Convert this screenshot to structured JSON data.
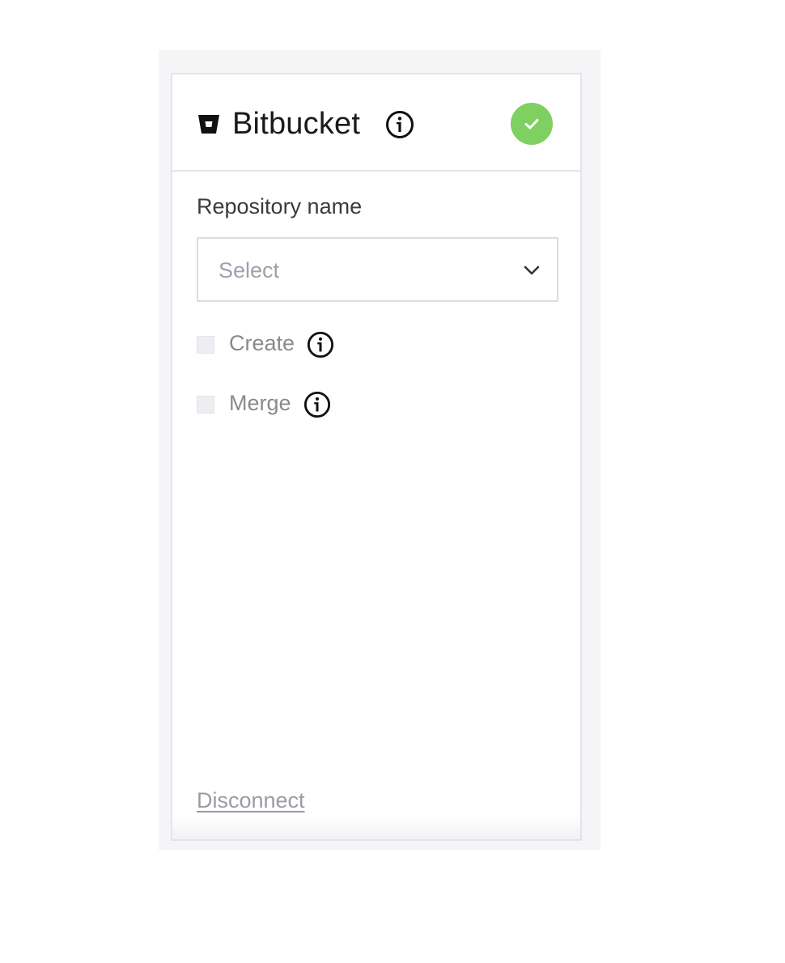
{
  "header": {
    "title": "Bitbucket",
    "logo_icon": "bitbucket-logo-icon",
    "info_icon": "info-icon",
    "status_icon": "check-icon",
    "status_color": "#7ed060"
  },
  "repository": {
    "label": "Repository name",
    "select_placeholder": "Select",
    "dropdown_icon": "chevron-down-icon"
  },
  "options": [
    {
      "label": "Create",
      "checked": false
    },
    {
      "label": "Merge",
      "checked": false
    }
  ],
  "footer": {
    "disconnect_label": "Disconnect"
  }
}
